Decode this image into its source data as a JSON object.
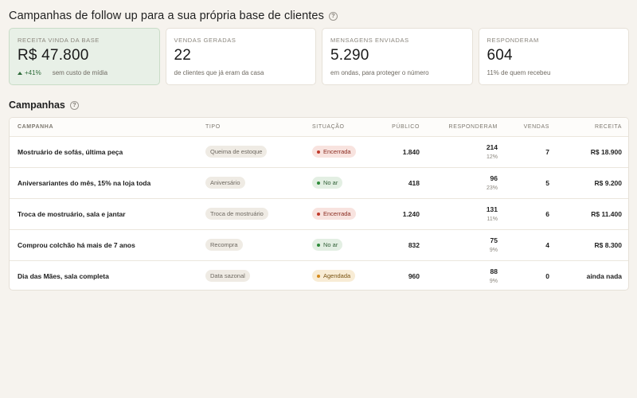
{
  "header": {
    "title": "Campanhas de follow up para a sua própria base de clientes",
    "help": "?"
  },
  "cards": [
    {
      "label": "RECEITA VINDA DA BASE",
      "value": "R$ 47.800",
      "trend": "+41%",
      "sub": "sem custo de mídia"
    },
    {
      "label": "VENDAS GERADAS",
      "value": "22",
      "sub": "de clientes que já eram da casa"
    },
    {
      "label": "MENSAGENS ENVIADAS",
      "value": "5.290",
      "sub": "em ondas, para proteger o número"
    },
    {
      "label": "RESPONDERAM",
      "value": "604",
      "sub": "11% de quem recebeu"
    }
  ],
  "section": {
    "title": "Campanhas",
    "help": "?"
  },
  "table": {
    "headers": [
      "CAMPANHA",
      "TIPO",
      "SITUAÇÃO",
      "PÚBLICO",
      "RESPONDERAM",
      "VENDAS",
      "RECEITA"
    ],
    "rows": [
      {
        "name": "Mostruário de sofás, última peça",
        "tipo": "Queima de estoque",
        "status": "Encerrada",
        "status_kind": "encerrada",
        "publico": "1.840",
        "resp": "214",
        "resp_pct": "12%",
        "vendas": "7",
        "receita": "R$ 18.900"
      },
      {
        "name": "Aniversariantes do mês, 15% na loja toda",
        "tipo": "Aniversário",
        "status": "No ar",
        "status_kind": "noar",
        "publico": "418",
        "resp": "96",
        "resp_pct": "23%",
        "vendas": "5",
        "receita": "R$ 9.200"
      },
      {
        "name": "Troca de mostruário, sala e jantar",
        "tipo": "Troca de mostruário",
        "status": "Encerrada",
        "status_kind": "encerrada",
        "publico": "1.240",
        "resp": "131",
        "resp_pct": "11%",
        "vendas": "6",
        "receita": "R$ 11.400"
      },
      {
        "name": "Comprou colchão há mais de 7 anos",
        "tipo": "Recompra",
        "status": "No ar",
        "status_kind": "noar",
        "publico": "832",
        "resp": "75",
        "resp_pct": "9%",
        "vendas": "4",
        "receita": "R$ 8.300"
      },
      {
        "name": "Dia das Mães, sala completa",
        "tipo": "Data sazonal",
        "status": "Agendada",
        "status_kind": "agendada",
        "publico": "960",
        "resp": "88",
        "resp_pct": "9%",
        "vendas": "0",
        "receita": "ainda nada"
      }
    ]
  },
  "colors": {
    "background": "#f6f3ee",
    "highlight_card": "#e8f0e7",
    "positive": "#2e6b3a",
    "encerrada": "#c0392b",
    "no_ar": "#2e8b3a",
    "agendada": "#d68a1a"
  }
}
